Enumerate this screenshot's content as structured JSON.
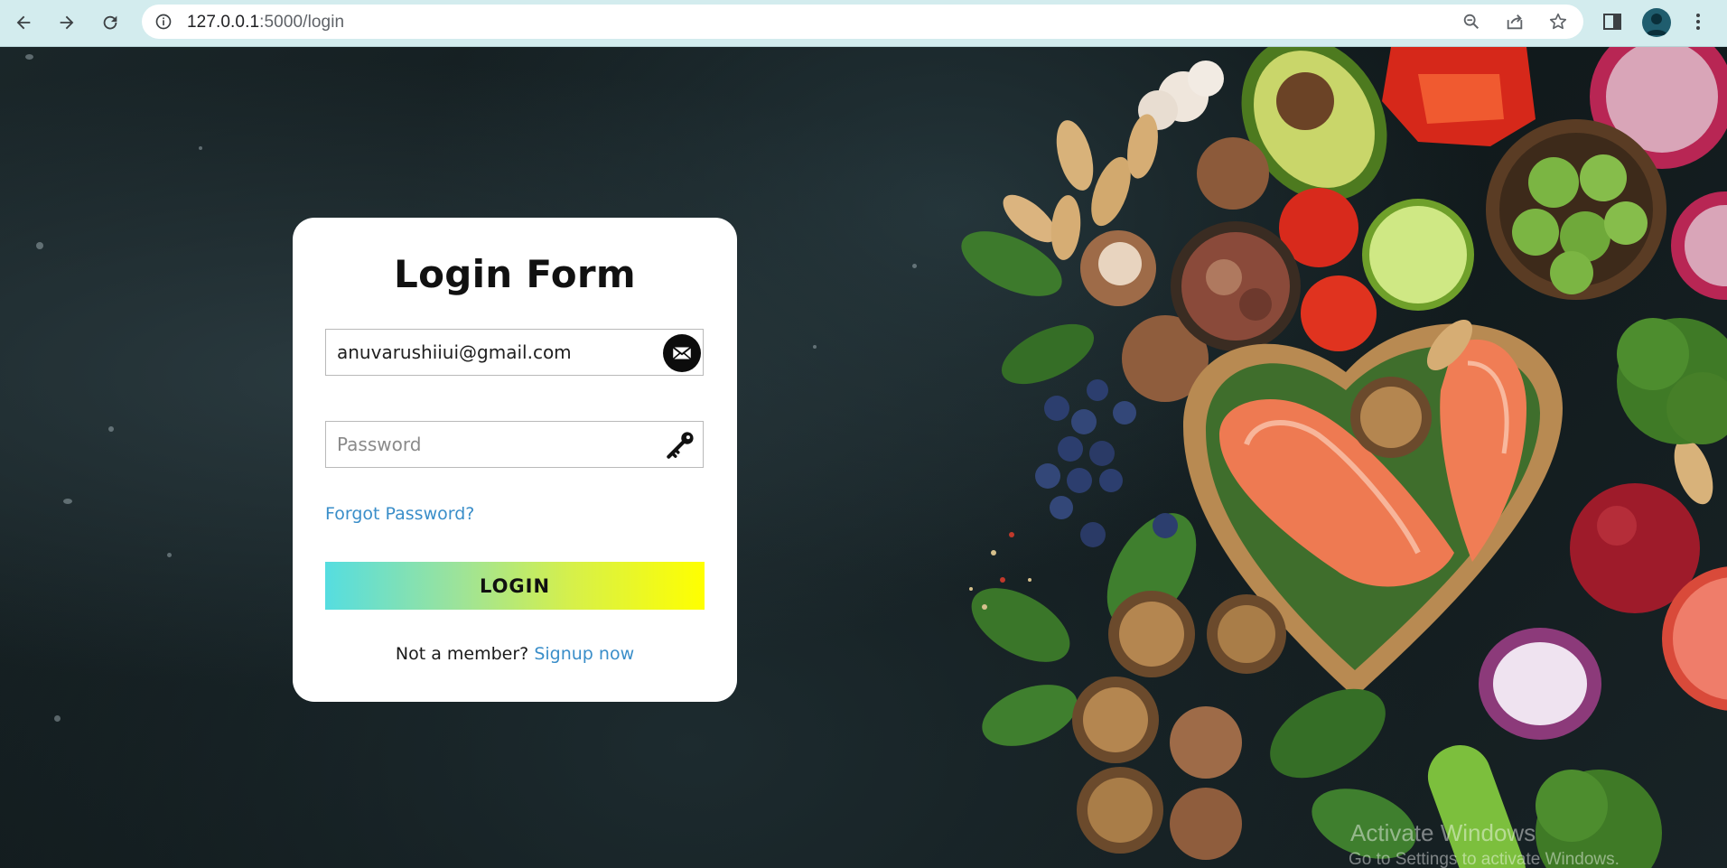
{
  "browser": {
    "url_host": "127.0.0.1",
    "url_path": ":5000/login",
    "icons": [
      "back-icon",
      "forward-icon",
      "reload-icon",
      "site-info-icon",
      "zoom-icon",
      "share-icon",
      "bookmark-star-icon",
      "side-panel-icon",
      "profile-avatar",
      "kebab-menu-icon"
    ]
  },
  "login": {
    "title": "Login Form",
    "email_value": "anuvarushiiui@gmail.com",
    "email_placeholder": "Email",
    "password_placeholder": "Password",
    "forgot_label": "Forgot Password?",
    "login_label": "LOGIN",
    "signup_prompt": "Not a member?",
    "signup_label": "Signup now"
  },
  "colors": {
    "link": "#3a8ec9",
    "button_gradient_start": "#55dde0",
    "button_gradient_end": "#ffff00",
    "chrome_bg": "#d3ecee"
  },
  "watermark": {
    "title": "Activate Windows",
    "subtitle": "Go to Settings to activate Windows."
  }
}
